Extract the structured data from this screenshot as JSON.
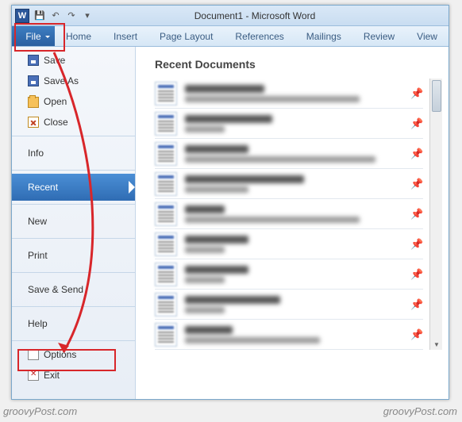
{
  "title": "Document1 - Microsoft Word",
  "word_logo": "W",
  "tabs": {
    "file": "File",
    "home": "Home",
    "insert": "Insert",
    "pagelayout": "Page Layout",
    "references": "References",
    "mailings": "Mailings",
    "review": "Review",
    "view": "View"
  },
  "sidebar": {
    "save": "Save",
    "save_as": "Save As",
    "open": "Open",
    "close": "Close",
    "info": "Info",
    "recent": "Recent",
    "new": "New",
    "print": "Print",
    "save_send": "Save & Send",
    "help": "Help",
    "options": "Options",
    "exit": "Exit"
  },
  "main": {
    "heading": "Recent Documents"
  },
  "recent_docs": [
    {
      "title_w": 100,
      "path_w": 220
    },
    {
      "title_w": 110,
      "path_w": 50
    },
    {
      "title_w": 80,
      "path_w": 240
    },
    {
      "title_w": 150,
      "path_w": 80
    },
    {
      "title_w": 50,
      "path_w": 220
    },
    {
      "title_w": 80,
      "path_w": 50
    },
    {
      "title_w": 80,
      "path_w": 50
    },
    {
      "title_w": 120,
      "path_w": 50
    },
    {
      "title_w": 60,
      "path_w": 170
    }
  ],
  "watermark": "groovyPost.com",
  "colors": {
    "ribbon_blue": "#2a5fa0",
    "annotation_red": "#d8262a"
  }
}
